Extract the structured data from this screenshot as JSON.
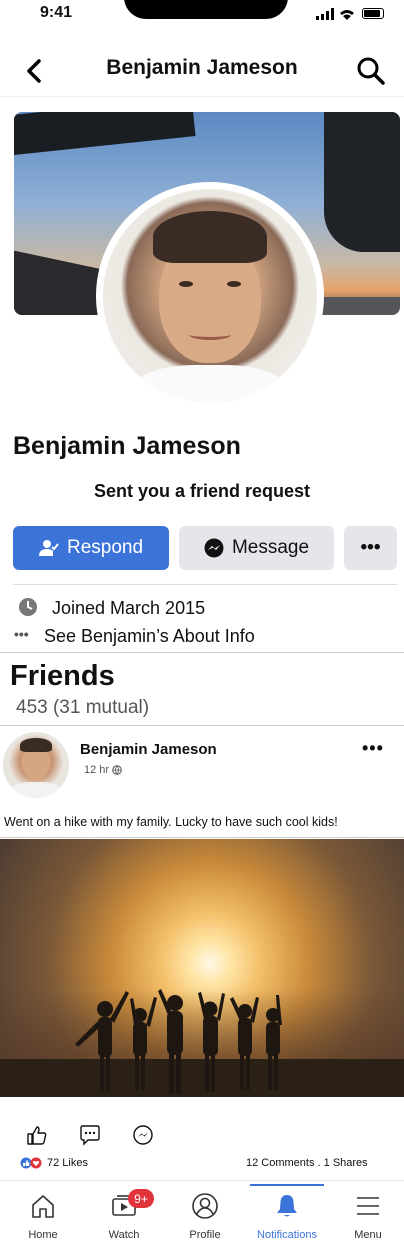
{
  "status_bar": {
    "time": "9:41"
  },
  "header": {
    "title": "Benjamin Jameson"
  },
  "profile": {
    "name": "Benjamin Jameson",
    "request_text": "Sent you a friend request",
    "respond_label": "Respond",
    "message_label": "Message",
    "more_label": "•••",
    "joined": "Joined March 2015",
    "about_link": "See Benjamin’s About Info",
    "about_icon_label": "•••"
  },
  "friends": {
    "title": "Friends",
    "count": "453 (31 mutual)"
  },
  "post": {
    "author": "Benjamin Jameson",
    "time": "12 hr",
    "more": "•••",
    "text": "Went on a hike with my family. Lucky to have such cool kids!",
    "likes": "72 Likes",
    "comments_shares": "12 Comments . 1 Shares"
  },
  "tabs": [
    {
      "label": "Home",
      "icon": "home-icon"
    },
    {
      "label": "Watch",
      "icon": "watch-icon",
      "badge": "9+"
    },
    {
      "label": "Profile",
      "icon": "profile-icon"
    },
    {
      "label": "Notifications",
      "icon": "bell-icon",
      "active": true
    },
    {
      "label": "Menu",
      "icon": "menu-icon"
    }
  ],
  "colors": {
    "accent": "#3b73d9",
    "badge": "#e0333a",
    "button_gray": "#e4e6ea"
  }
}
